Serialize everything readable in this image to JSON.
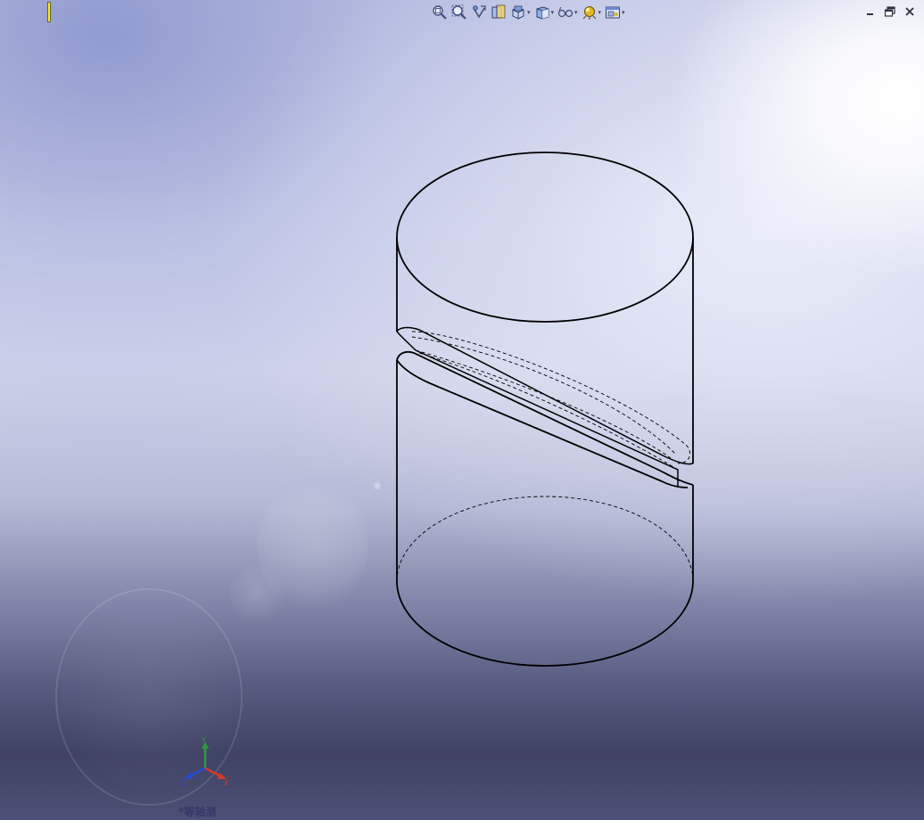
{
  "viewport": {
    "view_label": "*等轴测",
    "background_colors": {
      "top": "#c3c8e6",
      "bottom": "#3f4265",
      "highlight": "#ffffff"
    }
  },
  "feature_tree_handle": {
    "color": "#f5ef2a"
  },
  "view_toolbar": {
    "buttons": [
      {
        "icon": "zoom-to-fit-icon",
        "has_dropdown": false
      },
      {
        "icon": "zoom-to-area-icon",
        "has_dropdown": false
      },
      {
        "icon": "previous-view-icon",
        "has_dropdown": false
      },
      {
        "icon": "section-view-icon",
        "has_dropdown": false
      },
      {
        "icon": "view-orientation-icon",
        "has_dropdown": true
      },
      {
        "icon": "display-style-icon",
        "has_dropdown": true
      },
      {
        "icon": "hide-show-items-icon",
        "has_dropdown": true
      },
      {
        "icon": "edit-appearance-icon",
        "has_dropdown": true
      },
      {
        "icon": "view-settings-icon",
        "has_dropdown": true
      }
    ],
    "dropdown_glyph": "▾"
  },
  "window_controls": {
    "buttons": [
      "minimize-icon",
      "restore-icon",
      "close-icon"
    ]
  },
  "triad": {
    "axes": [
      {
        "label": "Y",
        "color": "#2e9a3a"
      },
      {
        "label": "X",
        "color": "#d83a2a"
      },
      {
        "label": "Z",
        "color": "#2a4ad0"
      }
    ]
  },
  "model": {
    "description_type": "wireframe",
    "line_color": "#000000"
  }
}
